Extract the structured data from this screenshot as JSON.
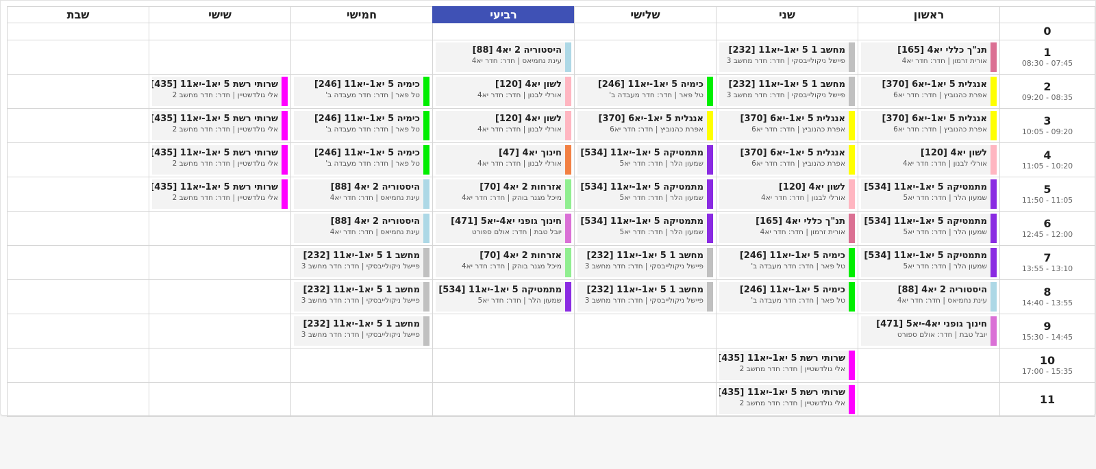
{
  "header": {
    "days": [
      "ראשון",
      "שני",
      "שלישי",
      "רביעי",
      "חמישי",
      "שישי",
      "שבת"
    ],
    "active_day": "רביעי"
  },
  "colors": {
    "tanakh": "#db7093",
    "english": "#ffff00",
    "lashon": "#ffb6c1",
    "math": "#8a2be2",
    "history": "#add8e6",
    "pe": "#da70d6",
    "netsec": "#ff00ff",
    "computer": "#c0c0c0",
    "chemistry": "#00ee00",
    "education": "#f28043",
    "civics": "#90ee90",
    "today": "#3f51b5"
  },
  "periods": [
    {
      "num": "0",
      "time": ""
    },
    {
      "num": "1",
      "time": "07:45 - 08:30"
    },
    {
      "num": "2",
      "time": "08:35 - 09:20"
    },
    {
      "num": "3",
      "time": "09:20 - 10:05"
    },
    {
      "num": "4",
      "time": "10:20 - 11:05"
    },
    {
      "num": "5",
      "time": "11:05 - 11:50"
    },
    {
      "num": "6",
      "time": "12:00 - 12:45"
    },
    {
      "num": "7",
      "time": "13:10 - 13:55"
    },
    {
      "num": "8",
      "time": "13:55 - 14:40"
    },
    {
      "num": "9",
      "time": "14:45 - 15:30"
    },
    {
      "num": "10",
      "time": "15:35 - 17:00"
    },
    {
      "num": "11",
      "time": ""
    }
  ],
  "schedule": [
    [
      null,
      null,
      null,
      null,
      null,
      null,
      null
    ],
    [
      {
        "title": "תנ\"ך כללי יא4 [165]",
        "detail": "אורית זרמון | חדר: חדר יא4",
        "color": "#db7093"
      },
      {
        "title": "מחשב 1 5 יא1-יא11 [232]",
        "detail": "פיישל ניקולייבסקי | חדר: חדר מחשב 3",
        "color": "#c0c0c0"
      },
      null,
      {
        "title": "היסטוריה 2 יא4 [88]",
        "detail": "עינת נחמיאס | חדר: חדר יא4",
        "color": "#add8e6"
      },
      null,
      null,
      null
    ],
    [
      {
        "title": "אנגלית 5 יא1-יא6 [370]",
        "detail": "אפרת כהנוביץ | חדר: חדר יא6",
        "color": "#ffff00"
      },
      {
        "title": "מחשב 1 5 יא1-יא11 [232]",
        "detail": "פיישל ניקולייבסקי | חדר: חדר מחשב 3",
        "color": "#c0c0c0"
      },
      {
        "title": "כימיה 5 יא1-יא11 [246]",
        "detail": "טל פאר | חדר: חדר מעבדה ב'",
        "color": "#00ee00"
      },
      {
        "title": "לשון יא4 [120]",
        "detail": "אורלי לבנון | חדר: חדר יא4",
        "color": "#ffb6c1"
      },
      {
        "title": "כימיה 5 יא1-יא11 [246]",
        "detail": "טל פאר | חדר: חדר מעבדה ב'",
        "color": "#00ee00"
      },
      {
        "title": "שרותי רשת 5 יא1-יא11 [435]",
        "detail": "אלי גולדשטיין | חדר: חדר מחשב 2",
        "color": "#ff00ff"
      },
      null
    ],
    [
      {
        "title": "אנגלית 5 יא1-יא6 [370]",
        "detail": "אפרת כהנוביץ | חדר: חדר יא6",
        "color": "#ffff00"
      },
      {
        "title": "אנגלית 5 יא1-יא6 [370]",
        "detail": "אפרת כהנוביץ | חדר: חדר יא6",
        "color": "#ffff00"
      },
      {
        "title": "אנגלית 5 יא1-יא6 [370]",
        "detail": "אפרת כהנוביץ | חדר: חדר יא6",
        "color": "#ffff00"
      },
      {
        "title": "לשון יא4 [120]",
        "detail": "אורלי לבנון | חדר: חדר יא4",
        "color": "#ffb6c1"
      },
      {
        "title": "כימיה 5 יא1-יא11 [246]",
        "detail": "טל פאר | חדר: חדר מעבדה ב'",
        "color": "#00ee00"
      },
      {
        "title": "שרותי רשת 5 יא1-יא11 [435]",
        "detail": "אלי גולדשטיין | חדר: חדר מחשב 2",
        "color": "#ff00ff"
      },
      null
    ],
    [
      {
        "title": "לשון יא4 [120]",
        "detail": "אורלי לבנון | חדר: חדר יא4",
        "color": "#ffb6c1"
      },
      {
        "title": "אנגלית 5 יא1-יא6 [370]",
        "detail": "אפרת כהנוביץ | חדר: חדר יא6",
        "color": "#ffff00"
      },
      {
        "title": "מתמטיקה 5 יא1-יא11 [534]",
        "detail": "שמעון הלר | חדר: חדר יא5",
        "color": "#8a2be2"
      },
      {
        "title": "חינוך יא4 [47]",
        "detail": "אורלי לבנון | חדר: חדר יא4",
        "color": "#f28043"
      },
      {
        "title": "כימיה 5 יא1-יא11 [246]",
        "detail": "טל פאר | חדר: חדר מעבדה ב'",
        "color": "#00ee00"
      },
      {
        "title": "שרותי רשת 5 יא1-יא11 [435]",
        "detail": "אלי גולדשטיין | חדר: חדר מחשב 2",
        "color": "#ff00ff"
      },
      null
    ],
    [
      {
        "title": "מתמטיקה 5 יא1-יא11 [534]",
        "detail": "שמעון הלר | חדר: חדר יא5",
        "color": "#8a2be2"
      },
      {
        "title": "לשון יא4 [120]",
        "detail": "אורלי לבנון | חדר: חדר יא4",
        "color": "#ffb6c1"
      },
      {
        "title": "מתמטיקה 5 יא1-יא11 [534]",
        "detail": "שמעון הלר | חדר: חדר יא5",
        "color": "#8a2be2"
      },
      {
        "title": "אזרחות 2 יא4 [70]",
        "detail": "מיכל מגנר בוהק | חדר: חדר יא4",
        "color": "#90ee90"
      },
      {
        "title": "היסטוריה 2 יא4 [88]",
        "detail": "עינת נחמיאס | חדר: חדר יא4",
        "color": "#add8e6"
      },
      {
        "title": "שרותי רשת 5 יא1-יא11 [435]",
        "detail": "אלי גולדשטיין | חדר: חדר מחשב 2",
        "color": "#ff00ff"
      },
      null
    ],
    [
      {
        "title": "מתמטיקה 5 יא1-יא11 [534]",
        "detail": "שמעון הלר | חדר: חדר יא5",
        "color": "#8a2be2"
      },
      {
        "title": "תנ\"ך כללי יא4 [165]",
        "detail": "אורית זרמון | חדר: חדר יא4",
        "color": "#db7093"
      },
      {
        "title": "מתמטיקה 5 יא1-יא11 [534]",
        "detail": "שמעון הלר | חדר: חדר יא5",
        "color": "#8a2be2"
      },
      {
        "title": "חינוך גופני יא4-יא5 [471]",
        "detail": "יובל טבת | חדר: אולם ספורט",
        "color": "#da70d6"
      },
      {
        "title": "היסטוריה 2 יא4 [88]",
        "detail": "עינת נחמיאס | חדר: חדר יא4",
        "color": "#add8e6"
      },
      null,
      null
    ],
    [
      {
        "title": "מתמטיקה 5 יא1-יא11 [534]",
        "detail": "שמעון הלר | חדר: חדר יא5",
        "color": "#8a2be2"
      },
      {
        "title": "כימיה 5 יא1-יא11 [246]",
        "detail": "טל פאר | חדר: חדר מעבדה ב'",
        "color": "#00ee00"
      },
      {
        "title": "מחשב 1 5 יא1-יא11 [232]",
        "detail": "פיישל ניקולייבסקי | חדר: חדר מחשב 3",
        "color": "#c0c0c0"
      },
      {
        "title": "אזרחות 2 יא4 [70]",
        "detail": "מיכל מגנר בוהק | חדר: חדר יא4",
        "color": "#90ee90"
      },
      {
        "title": "מחשב 1 5 יא1-יא11 [232]",
        "detail": "פיישל ניקולייבסקי | חדר: חדר מחשב 3",
        "color": "#c0c0c0"
      },
      null,
      null
    ],
    [
      {
        "title": "היסטוריה 2 יא4 [88]",
        "detail": "עינת נחמיאס | חדר: חדר יא4",
        "color": "#add8e6"
      },
      {
        "title": "כימיה 5 יא1-יא11 [246]",
        "detail": "טל פאר | חדר: חדר מעבדה ב'",
        "color": "#00ee00"
      },
      {
        "title": "מחשב 1 5 יא1-יא11 [232]",
        "detail": "פיישל ניקולייבסקי | חדר: חדר מחשב 3",
        "color": "#c0c0c0"
      },
      {
        "title": "מתמטיקה 5 יא1-יא11 [534]",
        "detail": "שמעון הלר | חדר: חדר יא5",
        "color": "#8a2be2"
      },
      {
        "title": "מחשב 1 5 יא1-יא11 [232]",
        "detail": "פיישל ניקולייבסקי | חדר: חדר מחשב 3",
        "color": "#c0c0c0"
      },
      null,
      null
    ],
    [
      {
        "title": "חינוך גופני יא4-יא5 [471]",
        "detail": "יובל טבת | חדר: אולם ספורט",
        "color": "#da70d6"
      },
      null,
      null,
      null,
      {
        "title": "מחשב 1 5 יא1-יא11 [232]",
        "detail": "פיישל ניקולייבסקי | חדר: חדר מחשב 3",
        "color": "#c0c0c0"
      },
      null,
      null
    ],
    [
      null,
      {
        "title": "שרותי רשת 5 יא1-יא11 [435]",
        "detail": "אלי גולדשטיין | חדר: חדר מחשב 2",
        "color": "#ff00ff"
      },
      null,
      null,
      null,
      null,
      null
    ],
    [
      null,
      {
        "title": "שרותי רשת 5 יא1-יא11 [435]",
        "detail": "אלי גולדשטיין | חדר: חדר מחשב 2",
        "color": "#ff00ff"
      },
      null,
      null,
      null,
      null,
      null
    ]
  ]
}
